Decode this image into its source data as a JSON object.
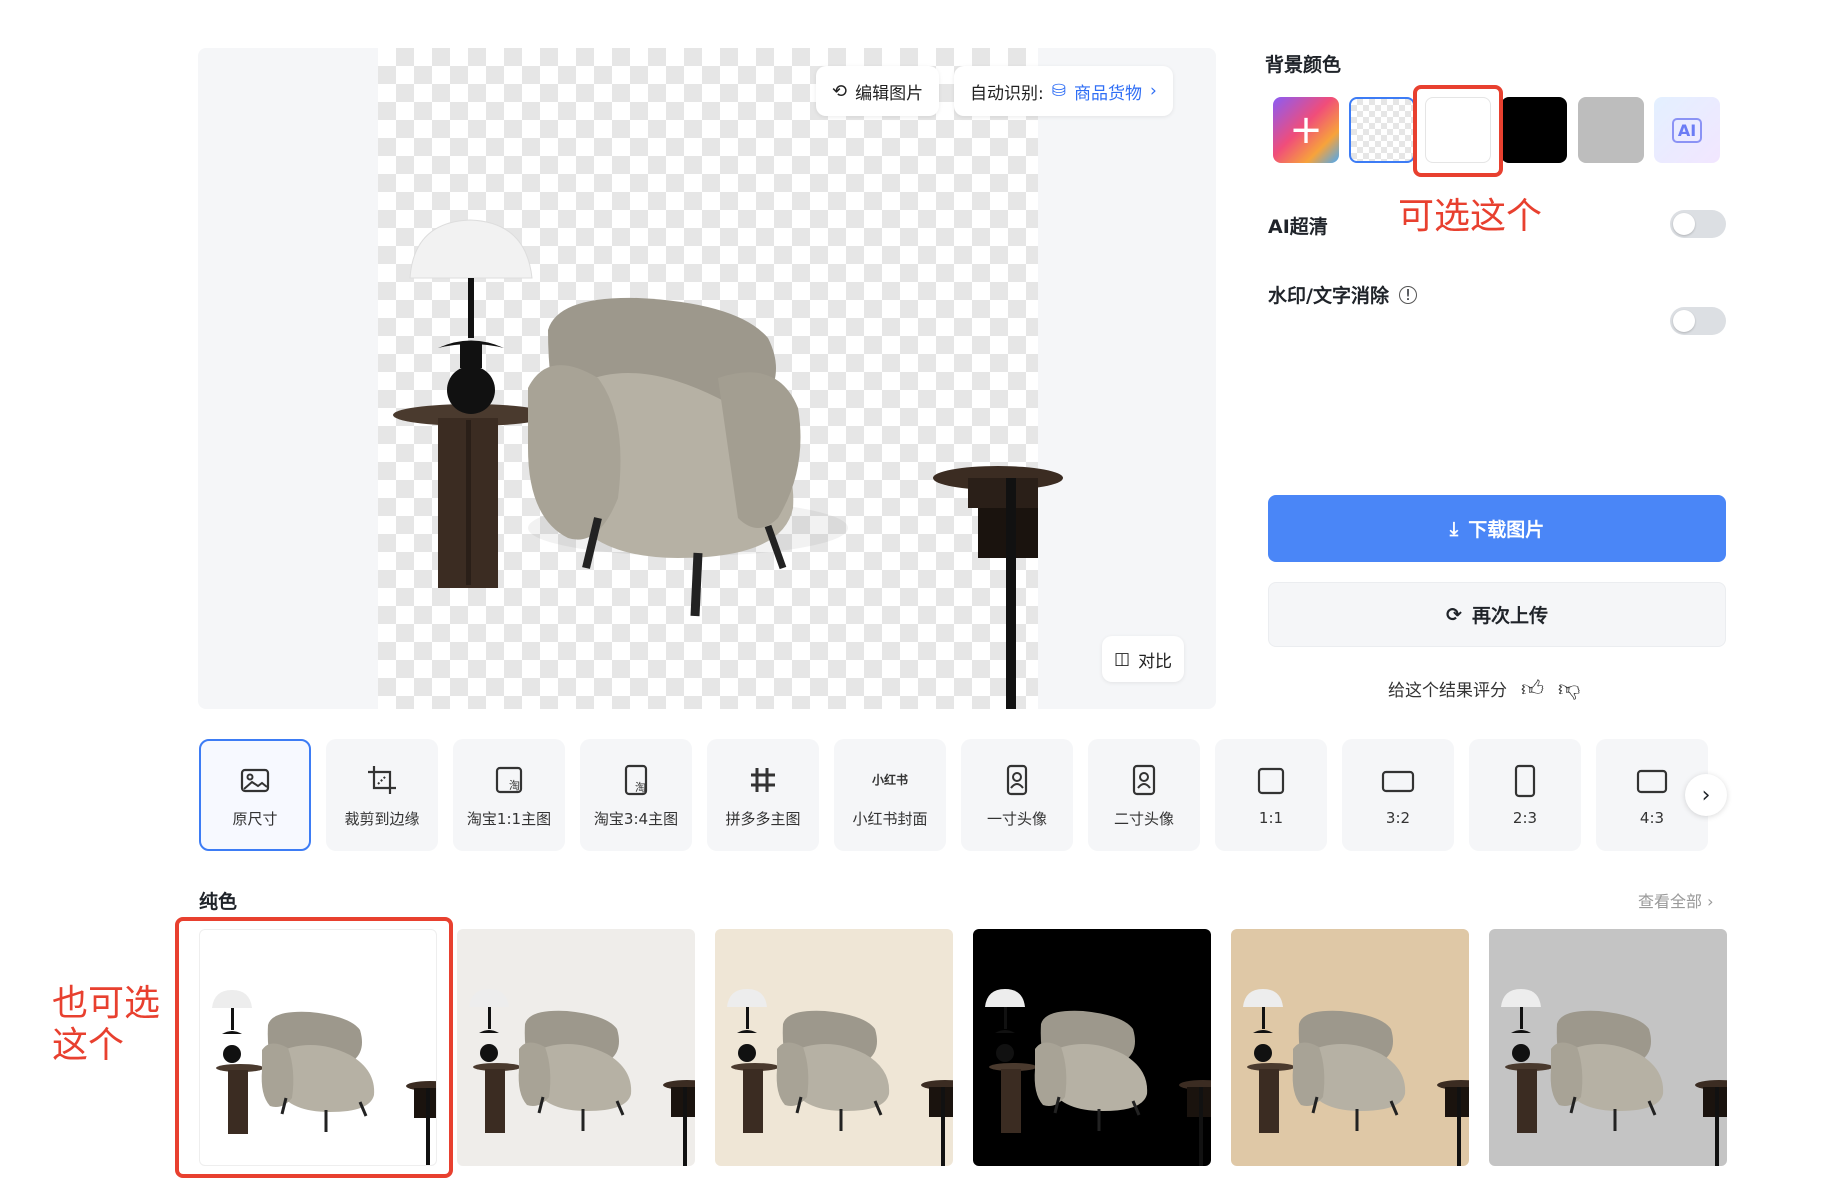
{
  "preview": {
    "edit_label": "编辑图片",
    "auto_detect_label": "自动识别:",
    "category_label": "商品货物",
    "compare_label": "对比"
  },
  "panel": {
    "bg_color_title": "背景颜色",
    "swatches": [
      {
        "name": "custom-color",
        "color": "gradient"
      },
      {
        "name": "transparent",
        "color": "checker"
      },
      {
        "name": "white",
        "color": "#ffffff"
      },
      {
        "name": "black",
        "color": "#000000"
      },
      {
        "name": "gray",
        "color": "#bdbdbd"
      },
      {
        "name": "ai",
        "color": "ai"
      }
    ],
    "ai_hd_label": "AI超清",
    "watermark_label": "水印/文字消除",
    "download_label": "下载图片",
    "reupload_label": "再次上传",
    "rate_label": "给这个结果评分"
  },
  "sizes": [
    {
      "label": "原尺寸",
      "icon": "image-icon",
      "selected": true
    },
    {
      "label": "裁剪到边缘",
      "icon": "crop-icon"
    },
    {
      "label": "淘宝1:1主图",
      "icon": "taobao-square-icon"
    },
    {
      "label": "淘宝3:4主图",
      "icon": "taobao-portrait-icon"
    },
    {
      "label": "拼多多主图",
      "icon": "pinduoduo-icon"
    },
    {
      "label": "小红书封面",
      "icon": "xiaohongshu-icon",
      "icon_text": "小红书"
    },
    {
      "label": "一寸头像",
      "icon": "portrait-1inch-icon"
    },
    {
      "label": "二寸头像",
      "icon": "portrait-2inch-icon"
    },
    {
      "label": "1:1",
      "icon": "square-icon"
    },
    {
      "label": "3:2",
      "icon": "landscape-icon"
    },
    {
      "label": "2:3",
      "icon": "portrait-icon"
    },
    {
      "label": "4:3",
      "icon": "landscape-43-icon"
    }
  ],
  "solid": {
    "title": "纯色",
    "view_all": "查看全部",
    "backgrounds": [
      "#ffffff",
      "#efedea",
      "#efe6d6",
      "#000000",
      "#dfc8a6",
      "#c4c4c4"
    ]
  },
  "annotations": {
    "swatch_note": "可选这个",
    "thumb_note_line1": "也可选",
    "thumb_note_line2": "这个",
    "color": "#e8402f"
  },
  "colors": {
    "accent": "#3d7cf5",
    "download_bg": "#4a86f7"
  }
}
